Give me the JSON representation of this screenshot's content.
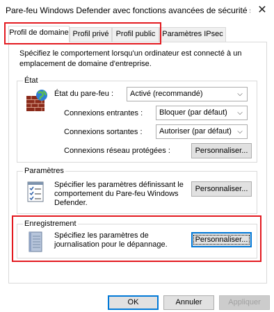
{
  "window": {
    "title": "Pare-feu Windows Defender avec fonctions avancées de sécurité s...",
    "close_glyph": "✕"
  },
  "tabs": [
    {
      "label": "Profil de domaine",
      "active": true
    },
    {
      "label": "Profil privé",
      "active": false
    },
    {
      "label": "Profil public",
      "active": false
    },
    {
      "label": "Paramètres IPsec",
      "active": false
    }
  ],
  "description": "Spécifiez le comportement lorsqu'un ordinateur  est connecté à un emplacement de domaine d'entreprise.",
  "state_group": {
    "legend": "État",
    "firewall_state_label": "État du pare-feu :",
    "firewall_state_value": "Activé (recommandé)",
    "inbound_label": "Connexions entrantes :",
    "inbound_value": "Bloquer (par défaut)",
    "outbound_label": "Connexions sortantes :",
    "outbound_value": "Autoriser (par défaut)",
    "protected_label": "Connexions réseau protégées :",
    "protected_button": "Personnaliser..."
  },
  "settings_group": {
    "legend": "Paramètres",
    "text": "Spécifier les paramètres définissant le comportement du Pare-feu Windows Defender.",
    "button": "Personnaliser..."
  },
  "logging_group": {
    "legend": "Enregistrement",
    "text": "Spécifiez les paramètres de journalisation pour le dépannage.",
    "button": "Personnaliser..."
  },
  "footer": {
    "ok": "OK",
    "cancel": "Annuler",
    "apply": "Appliquer"
  },
  "icons": {
    "firewall": "firewall-brick-globe-icon",
    "settings": "checklist-icon",
    "logging": "notebook-icon",
    "dropdown": "chevron-down-icon",
    "close": "close-icon"
  },
  "colors": {
    "highlight": "#e3191f",
    "focus": "#0078d7"
  }
}
